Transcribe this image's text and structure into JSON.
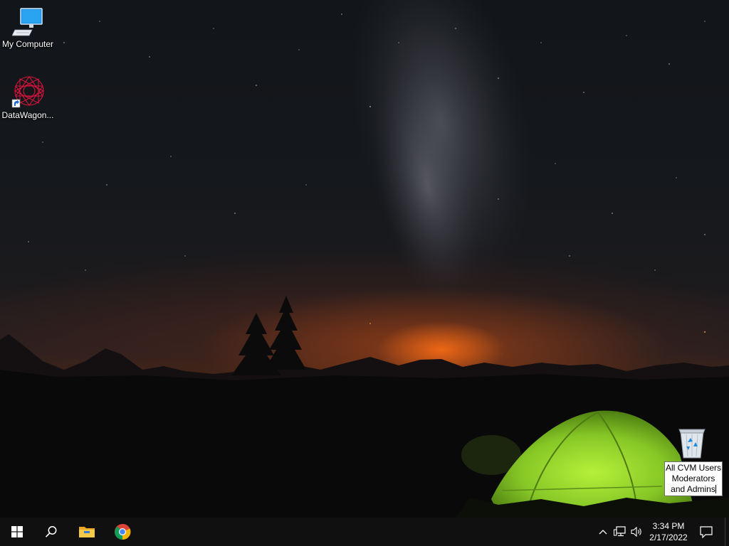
{
  "desktop": {
    "icons": [
      {
        "label": "My Computer",
        "icon": "computer-monitor-icon"
      },
      {
        "label": "DataWagon...",
        "icon": "datawagon-shortcut-icon"
      },
      {
        "label": "All CVM Users Moderators and Admins",
        "icon": "recycle-bin-icon",
        "renaming": true
      }
    ]
  },
  "taskbar": {
    "start_icon": "windows-logo-icon",
    "search_icon": "search-icon",
    "pinned": [
      {
        "name": "File Explorer",
        "icon": "folder-icon"
      },
      {
        "name": "Google Chrome",
        "icon": "chrome-icon"
      }
    ],
    "tray": {
      "chevron_icon": "chevron-up-icon",
      "network_icon": "network-icon",
      "volume_icon": "speaker-icon",
      "time": "3:34 PM",
      "date": "2/17/2022",
      "notification_icon": "notification-icon"
    }
  },
  "colors": {
    "taskbar": "#101010",
    "tent_green": "#8fd12a",
    "horizon_glow": "#e0641a",
    "windows_blue": "#ffffff"
  }
}
